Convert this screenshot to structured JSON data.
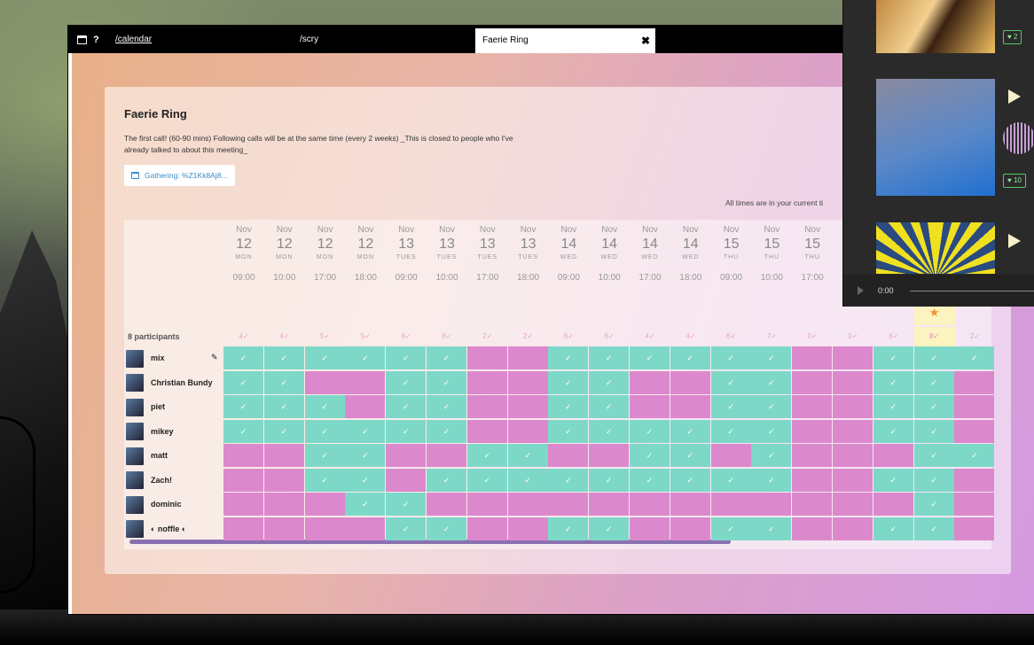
{
  "tabs": {
    "calendar": "/calendar",
    "scry": "/scry",
    "active": "Faerie Ring",
    "close": "✖",
    "help": "?"
  },
  "event": {
    "title": "Faerie Ring",
    "description": "The first call! (60-90 mins) Following calls will be at the same time (every 2 weeks) _This is closed to people who I've already talked to about this meeting_",
    "gathering": "Gathering: %Z1Kk8Aj8...",
    "timezone_note": "All times are in your current ti"
  },
  "grid": {
    "participants_label": "8 participants",
    "columns": [
      {
        "month": "Nov",
        "day": "12",
        "weekday": "MON",
        "time": "09:00",
        "count": "4✓"
      },
      {
        "month": "Nov",
        "day": "12",
        "weekday": "MON",
        "time": "10:00",
        "count": "4✓"
      },
      {
        "month": "Nov",
        "day": "12",
        "weekday": "MON",
        "time": "17:00",
        "count": "5✓"
      },
      {
        "month": "Nov",
        "day": "12",
        "weekday": "MON",
        "time": "18:00",
        "count": "5✓"
      },
      {
        "month": "Nov",
        "day": "13",
        "weekday": "TUES",
        "time": "09:00",
        "count": "6✓"
      },
      {
        "month": "Nov",
        "day": "13",
        "weekday": "TUES",
        "time": "10:00",
        "count": "6✓"
      },
      {
        "month": "Nov",
        "day": "13",
        "weekday": "TUES",
        "time": "17:00",
        "count": "2✓"
      },
      {
        "month": "Nov",
        "day": "13",
        "weekday": "TUES",
        "time": "18:00",
        "count": "2✓"
      },
      {
        "month": "Nov",
        "day": "14",
        "weekday": "WED",
        "time": "09:00",
        "count": "6✓"
      },
      {
        "month": "Nov",
        "day": "14",
        "weekday": "WED",
        "time": "10:00",
        "count": "6✓"
      },
      {
        "month": "Nov",
        "day": "14",
        "weekday": "WED",
        "time": "17:00",
        "count": "4✓"
      },
      {
        "month": "Nov",
        "day": "14",
        "weekday": "WED",
        "time": "18:00",
        "count": "4✓"
      },
      {
        "month": "Nov",
        "day": "15",
        "weekday": "THU",
        "time": "09:00",
        "count": "6✓"
      },
      {
        "month": "Nov",
        "day": "15",
        "weekday": "THU",
        "time": "10:00",
        "count": "7✓"
      },
      {
        "month": "Nov",
        "day": "15",
        "weekday": "THU",
        "time": "17:00",
        "count": "0✓"
      },
      {
        "month": "",
        "day": "",
        "weekday": "",
        "time": "",
        "count": "0✓"
      },
      {
        "month": "",
        "day": "",
        "weekday": "",
        "time": "",
        "count": "6✓"
      },
      {
        "month": "",
        "day": "",
        "weekday": "",
        "time": "",
        "count": "8✓",
        "best": true
      },
      {
        "month": "",
        "day": "",
        "weekday": "",
        "time": "",
        "count": "2✓"
      }
    ],
    "check": "✓",
    "participants": [
      {
        "name": "mix",
        "avail": [
          1,
          1,
          1,
          1,
          1,
          1,
          0,
          0,
          1,
          1,
          1,
          1,
          1,
          1,
          0,
          0,
          1,
          1,
          1
        ]
      },
      {
        "name": "Christian Bundy",
        "avail": [
          1,
          1,
          0,
          0,
          1,
          1,
          0,
          0,
          1,
          1,
          0,
          0,
          1,
          1,
          0,
          0,
          1,
          1,
          0
        ]
      },
      {
        "name": "piet",
        "avail": [
          1,
          1,
          1,
          0,
          1,
          1,
          0,
          0,
          1,
          1,
          0,
          0,
          1,
          1,
          0,
          0,
          1,
          1,
          0
        ]
      },
      {
        "name": "mikey",
        "avail": [
          1,
          1,
          1,
          1,
          1,
          1,
          0,
          0,
          1,
          1,
          1,
          1,
          1,
          1,
          0,
          0,
          1,
          1,
          0
        ]
      },
      {
        "name": "matt",
        "avail": [
          0,
          0,
          1,
          1,
          0,
          0,
          1,
          1,
          0,
          0,
          1,
          1,
          0,
          1,
          0,
          0,
          0,
          1,
          1
        ]
      },
      {
        "name": "Zach!",
        "avail": [
          0,
          0,
          1,
          1,
          0,
          1,
          1,
          1,
          1,
          1,
          1,
          1,
          1,
          1,
          0,
          0,
          1,
          1,
          0
        ]
      },
      {
        "name": "dominic",
        "avail": [
          0,
          0,
          0,
          1,
          1,
          0,
          0,
          0,
          0,
          0,
          0,
          0,
          0,
          0,
          0,
          0,
          0,
          1,
          0
        ]
      },
      {
        "name": "◐ noffle ◐",
        "avail": [
          0,
          0,
          0,
          0,
          1,
          1,
          0,
          0,
          1,
          1,
          0,
          0,
          1,
          1,
          0,
          0,
          1,
          1,
          0
        ]
      }
    ]
  },
  "player": {
    "likes": [
      "2",
      "10"
    ],
    "time": "0:00"
  },
  "colors": {
    "yes": "#7ed8c8",
    "no": "#dc88cc",
    "best_highlight": "#fdf3c0",
    "star": "#f09030"
  }
}
